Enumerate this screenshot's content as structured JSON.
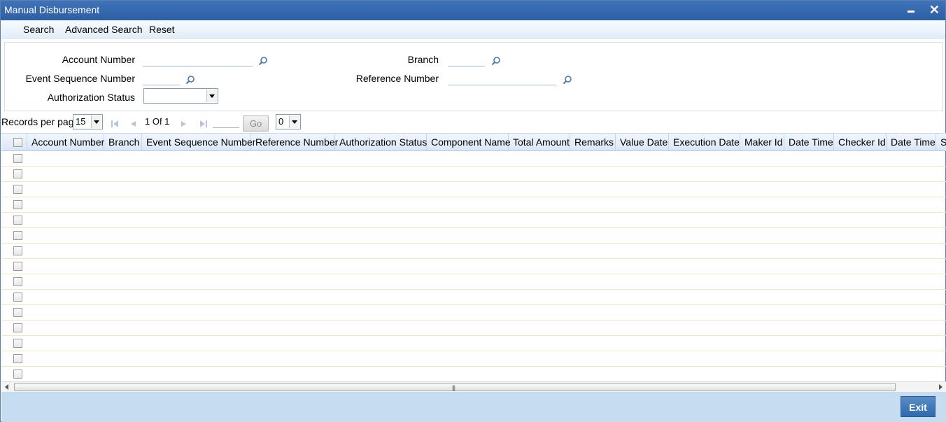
{
  "window": {
    "title": "Manual Disbursement"
  },
  "menu": {
    "search": "Search",
    "advanced_search": "Advanced Search",
    "reset": "Reset"
  },
  "search_form": {
    "account_number_label": "Account Number",
    "account_number_value": "",
    "branch_label": "Branch",
    "branch_value": "",
    "event_sequence_label": "Event Sequence Number",
    "event_sequence_value": "",
    "reference_number_label": "Reference Number",
    "reference_number_value": "",
    "authorization_status_label": "Authorization Status",
    "authorization_status_value": ""
  },
  "pager": {
    "records_per_page_label": "Records per page",
    "records_per_page_value": "15",
    "page_info": "1 Of 1",
    "go_label": "Go",
    "page_select_value": "0"
  },
  "grid": {
    "columns": [
      "Account Number",
      "Branch",
      "Event Sequence Number",
      "Reference Number",
      "Authorization Status",
      "Component Name",
      "Total Amount",
      "Remarks",
      "Value Date",
      "Execution Date",
      "Maker Id",
      "Date Time",
      "Checker Id",
      "Date Time",
      "S"
    ],
    "empty_rows": 15
  },
  "footer": {
    "exit_label": "Exit"
  },
  "colors": {
    "title_bar": "#2c5fa3",
    "footer": "#c5dcf1",
    "exit_button": "#2f68ad"
  }
}
